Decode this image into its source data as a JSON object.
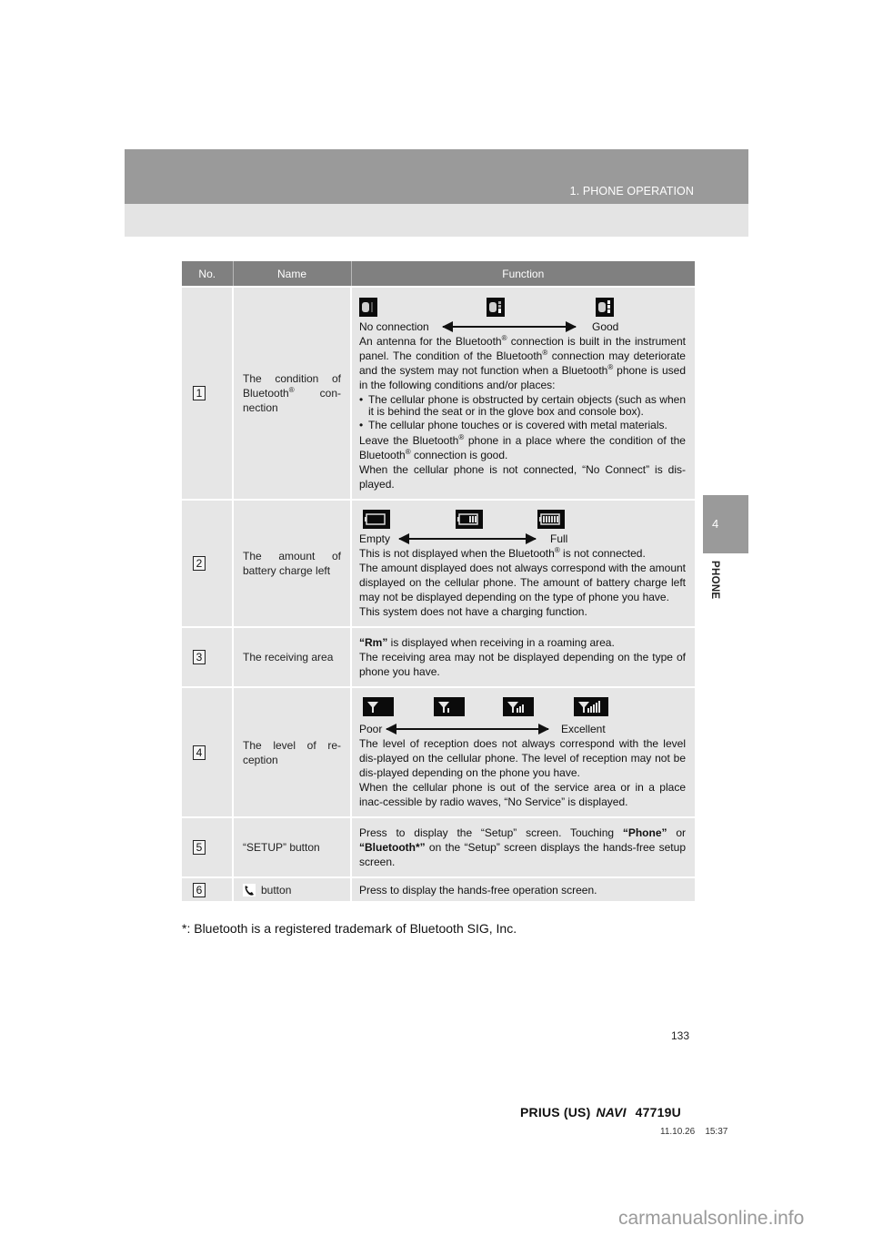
{
  "header": {
    "section_title": "1. PHONE OPERATION"
  },
  "side_tab": {
    "chapter_number": "4",
    "chapter_label": "PHONE"
  },
  "table": {
    "columns": [
      "No.",
      "Name",
      "Function"
    ],
    "rows": [
      {
        "no": "1",
        "name_parts": [
          "The condition of Bluetooth",
          "®",
          " con-nection"
        ],
        "scale": {
          "icons": [
            "bluetooth-no-connection-icon",
            "bluetooth-medium-icon",
            "bluetooth-good-icon"
          ],
          "left_label": "No connection",
          "right_label": "Good"
        },
        "p1": [
          "An antenna for the Bluetooth",
          "®",
          " connection is built in the instrument panel. The condition of the Bluetooth",
          "®",
          " connection may deteriorate and the system may not function when a Bluetooth",
          "®",
          " phone is used in the following conditions and/or places:"
        ],
        "bullets": [
          "The cellular phone is obstructed by certain objects (such as when it is behind the seat or in the glove box and console box).",
          "The cellular phone touches or is covered with metal materials."
        ],
        "p2": [
          "Leave the Bluetooth",
          "®",
          " phone in a place where the condition of the Bluetooth",
          "®",
          " connection is good."
        ],
        "p3": "When the cellular phone is not connected, “No Connect” is dis-played."
      },
      {
        "no": "2",
        "name": "The amount of battery charge left",
        "scale": {
          "icons": [
            "battery-empty-icon",
            "battery-half-icon",
            "battery-full-icon"
          ],
          "left_label": "Empty",
          "right_label": "Full"
        },
        "p1": [
          "This is not displayed when the Bluetooth",
          "®",
          " is not connected."
        ],
        "p2": "The amount displayed does not always correspond with the amount displayed on the cellular phone. The amount of battery charge left may not be displayed depending on the type of phone you have.",
        "p3": "This system does not have a charging function."
      },
      {
        "no": "3",
        "name": "The receiving area",
        "bold_lead": "“Rm”",
        "p1": " is displayed when receiving in a roaming area.",
        "p2": "The receiving area may not be displayed depending on the type of phone you have."
      },
      {
        "no": "4",
        "name": "The level of re-ception",
        "scale": {
          "icons": [
            "signal-0-icon",
            "signal-1-icon",
            "signal-3-icon",
            "signal-5-icon"
          ],
          "left_label": "Poor",
          "right_label": "Excellent"
        },
        "p1": "The level of reception does not always correspond with the level dis-played on the cellular phone. The level of reception may not be dis-played depending on the phone you have.",
        "p2": "When the cellular phone is out of the service area or in a place inac-cessible by radio waves, “No Service” is displayed."
      },
      {
        "no": "5",
        "name": "“SETUP” button",
        "t1": "Press to display the “Setup” screen. Touching ",
        "b1": "“Phone”",
        "t2": " or ",
        "b2": "“Bluetooth*”",
        "t3": " on the “Setup” screen displays the hands-free setup screen."
      },
      {
        "no": "6",
        "name_icon": "phone-handset-icon",
        "name": "button",
        "func": "Press to display the hands-free operation screen."
      }
    ]
  },
  "footnote": "*: Bluetooth is a registered trademark of Bluetooth SIG, Inc.",
  "page_number": "133",
  "footer": {
    "model": "PRIUS (US)",
    "navi": "NAVI",
    "code": "47719U",
    "date": "11.10.26",
    "time": "15:37"
  },
  "watermark": "carmanualsonline.info"
}
